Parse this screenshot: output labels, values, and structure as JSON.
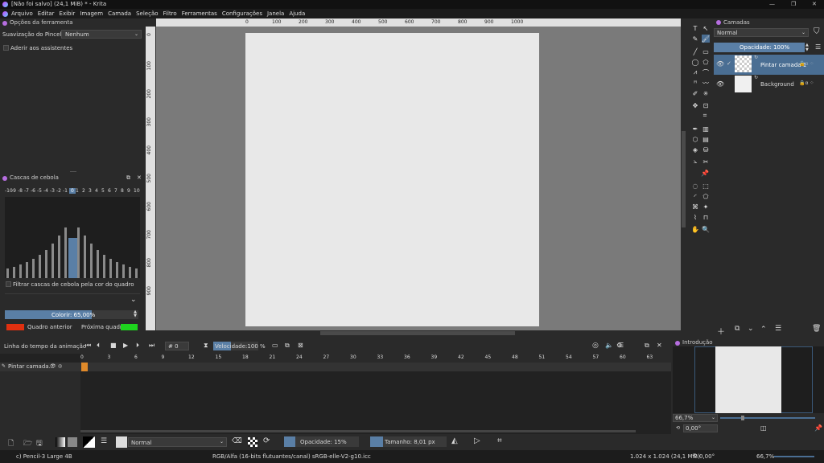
{
  "window": {
    "title": "[Não foi salvo]  (24,1 MiB) * - Krita",
    "controls": [
      "—",
      "❐",
      "✕"
    ]
  },
  "menu": [
    "Arquivo",
    "Editar",
    "Exibir",
    "Imagem",
    "Camada",
    "Seleção",
    "Filtro",
    "Ferramentas",
    "Configurações",
    "Janela",
    "Ajuda"
  ],
  "tool_options": {
    "title": "Opções da ferramenta",
    "smoothing_label": "Suavização do Pincel:",
    "smoothing_value": "Nenhum",
    "assistants_label": "Aderir aos assistentes"
  },
  "onion": {
    "title": "Cascas de cebola",
    "frames": [
      "-10",
      "-9",
      "-8",
      "-7",
      "-6",
      "-5",
      "-4",
      "-3",
      "-2",
      "-1",
      "0",
      "1",
      "2",
      "3",
      "4",
      "5",
      "6",
      "7",
      "8",
      "9",
      "10"
    ],
    "opacity_levels": [
      0.12,
      0.14,
      0.17,
      0.2,
      0.24,
      0.29,
      0.35,
      0.43,
      0.52,
      0.62,
      0.5,
      0.62,
      0.52,
      0.43,
      0.35,
      0.29,
      0.24,
      0.2,
      0.17,
      0.14,
      0.12
    ],
    "filter_label": "Filtrar cascas de cebola pela cor do quadro",
    "tint_label": "Colorir: 65,00%",
    "tint_value": 0.65,
    "prev_label": "Quadro anterior",
    "next_label": "Próxima quadro",
    "prev_color": "#e03010",
    "next_color": "#1ed41e"
  },
  "rulers": {
    "h": [
      "0",
      "100",
      "200",
      "300",
      "400",
      "500",
      "600",
      "700",
      "800",
      "900",
      "1000"
    ],
    "v": [
      "0",
      "100",
      "200",
      "300",
      "400",
      "500",
      "600",
      "700",
      "800",
      "900"
    ]
  },
  "timeline": {
    "title": "Linha do tempo da animação",
    "frame_field": "# 0",
    "speed_label": "Velocidade:100 %",
    "ticks": [
      "0",
      "3",
      "6",
      "9",
      "12",
      "15",
      "18",
      "21",
      "24",
      "27",
      "30",
      "33",
      "36",
      "39",
      "42",
      "45",
      "48",
      "51",
      "54",
      "57",
      "60",
      "63"
    ],
    "layer_name": "Pintar camada..."
  },
  "layers": {
    "title": "Camadas",
    "blend_mode": "Normal",
    "opacity_label": "Opacidade:  100%",
    "items": [
      {
        "name": "Pintar camada 1",
        "selected": true
      },
      {
        "name": "Background",
        "selected": false
      }
    ]
  },
  "overview": {
    "title": "Introdução",
    "zoom": "66,7%",
    "rotation": "0,00°"
  },
  "toolbar": {
    "blend_mode": "Normal",
    "opacity": "Opacidade: 15%",
    "size": "Tamanho: 8,01 px"
  },
  "status": {
    "brush": "c) Pencil-3 Large 4B",
    "color_profile": "RGB/Alfa (16-bits flutuantes/canal)  sRGB-elle-V2-g10.icc",
    "dimensions": "1.024 x 1.024 (24,1 MiB)",
    "rotation": "0,00°",
    "zoom": "66,7%"
  },
  "colors": {
    "accent": "#5a7fa6",
    "canvas": "#e8e8e8",
    "workspace": "#7a7a7a"
  }
}
